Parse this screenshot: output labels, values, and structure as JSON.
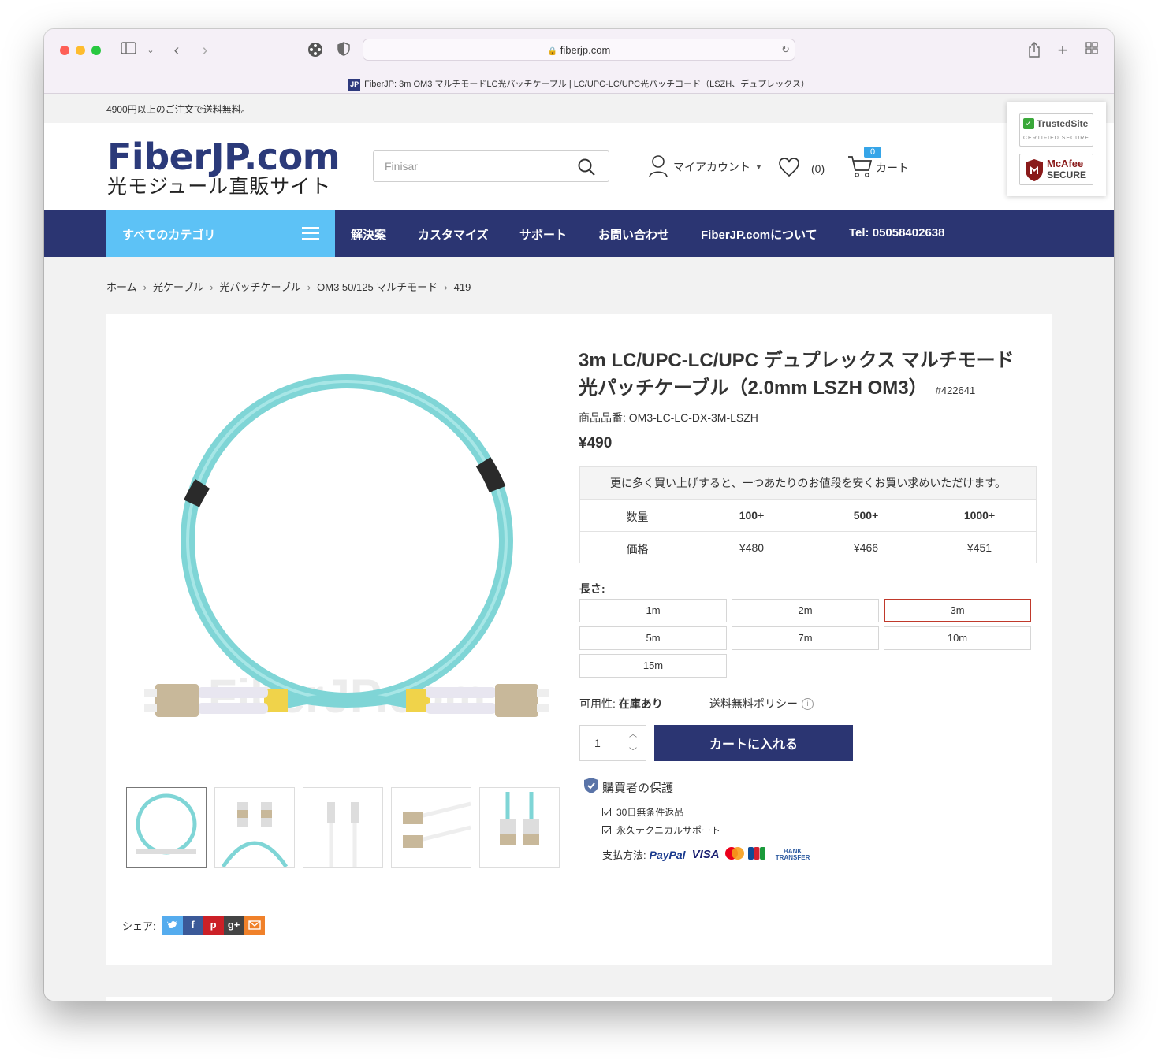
{
  "browser": {
    "url": "fiberjp.com",
    "tab_title": "FiberJP: 3m OM3 マルチモードLC光パッチケーブル | LC/UPC-LC/UPC光パッチコード（LSZH、デュプレックス）",
    "favicon_text": "JP"
  },
  "top_note": "4900円以上のご注文で送料無料。",
  "header": {
    "logo_main": "FiberJP.com",
    "logo_sub": "光モジュール直販サイト",
    "search_placeholder": "Finisar",
    "account_label": "マイアカウント",
    "wishlist_count": "(0)",
    "cart_label": "カート",
    "cart_count": "0"
  },
  "trust": {
    "trustedsite": "TrustedSite",
    "trustedsite_sub": "CERTIFIED SECURE",
    "mcafee": "McAfee",
    "mcafee_sub": "SECURE"
  },
  "nav": {
    "all_categories": "すべてのカテゴリ",
    "items": [
      "解決案",
      "カスタマイズ",
      "サポート",
      "お問い合わせ",
      "FiberJP.comについて",
      "Tel: 05058402638"
    ]
  },
  "breadcrumb": [
    "ホーム",
    "光ケーブル",
    "光パッチケーブル",
    "OM3 50/125 マルチモード",
    "419"
  ],
  "product": {
    "title": "3m LC/UPC-LC/UPC デュプレックス マルチモード 光パッチケーブル（2.0mm LSZH OM3）",
    "sku": "#422641",
    "part_number": "商品品番: OM3-LC-LC-DX-3M-LSZH",
    "price": "¥490",
    "tier_note": "更に多く買い上げすると、一つあたりのお値段を安くお買い求めいただけます。",
    "tier_headers": [
      "数量",
      "100+",
      "500+",
      "1000+"
    ],
    "tier_prices": [
      "価格",
      "¥480",
      "¥466",
      "¥451"
    ],
    "length_label": "長さ:",
    "lengths": [
      "1m",
      "2m",
      "3m",
      "5m",
      "7m",
      "10m",
      "15m"
    ],
    "selected_length": "3m",
    "availability_label": "可用性:",
    "availability_value": "在庫あり",
    "shipping_policy": "送料無料ポリシー",
    "quantity": "1",
    "add_to_cart": "カートに入れる",
    "protection_title": "購買者の保護",
    "protections": [
      "30日無条件返品",
      "永久テクニカルサポート"
    ],
    "payment_label": "支払方法:",
    "payment_methods": [
      "PayPal",
      "VISA",
      "BANK TRANSFER"
    ],
    "share_label": "シェア:",
    "watermark": "FiberJP.com"
  },
  "colors": {
    "navy": "#2b3572",
    "sky": "#5dc2f6",
    "aqua": "#6fd3d6",
    "selected_border": "#c0392b"
  }
}
